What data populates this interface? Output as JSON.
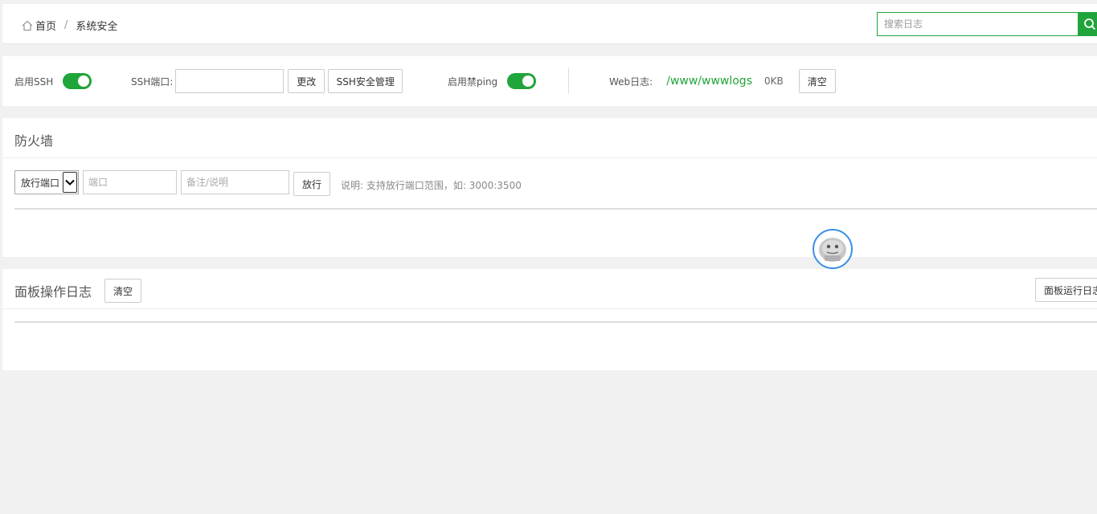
{
  "breadcrumb": {
    "home_label": "首页",
    "separator": "/",
    "current_label": "系统安全"
  },
  "search": {
    "placeholder": "搜索日志",
    "value": ""
  },
  "ssh": {
    "enable_label": "启用SSH",
    "enable_on": true,
    "port_label": "SSH端口:",
    "port_value": "",
    "change_button": "更改",
    "manage_button": "SSH安全管理",
    "ping_label": "启用禁ping",
    "ping_on": true,
    "web_log_label": "Web日志:",
    "web_log_path": "/www/wwwlogs",
    "web_log_size": "0KB",
    "clear_button": "清空"
  },
  "firewall": {
    "title": "防火墙",
    "select_value": "放行端口",
    "port_placeholder": "端口",
    "note_placeholder": "备注/说明",
    "allow_button": "放行",
    "hint": "说明: 支持放行端口范围，如: 3000:3500"
  },
  "oplog": {
    "title": "面板操作日志",
    "clear_button": "清空",
    "run_log_button": "面板运行日志"
  },
  "colors": {
    "accent": "#20a53a",
    "avatar_border": "#3a8ee6"
  }
}
